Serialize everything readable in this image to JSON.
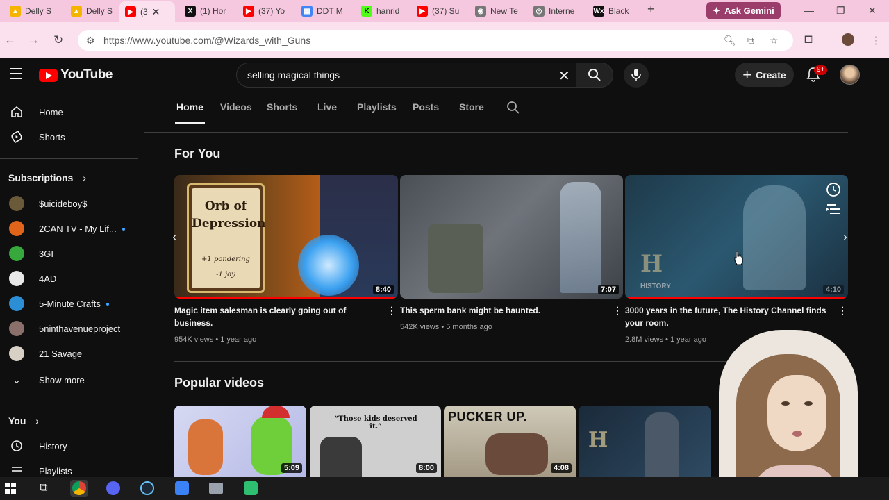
{
  "browser": {
    "tabs": [
      {
        "label": "Delly S",
        "favicon": "drive-icon"
      },
      {
        "label": "Delly S",
        "favicon": "drive-icon"
      },
      {
        "label": "(3",
        "favicon": "youtube-icon",
        "active": true
      },
      {
        "label": "(1) Hor",
        "favicon": "x-icon"
      },
      {
        "label": "(37) Yo",
        "favicon": "youtube-icon"
      },
      {
        "label": "DDT M",
        "favicon": "calendar-icon"
      },
      {
        "label": "hanrid",
        "favicon": "kick-icon"
      },
      {
        "label": "(37) Su",
        "favicon": "youtube-icon"
      },
      {
        "label": "New Te",
        "favicon": "chrome-icon"
      },
      {
        "label": "Interne",
        "favicon": "globe-icon"
      },
      {
        "label": "Black",
        "favicon": "wix-icon"
      }
    ],
    "ask_gemini": "Ask Gemini",
    "url": "https://www.youtube.com/@Wizards_with_Guns",
    "accent": "#f6c8df"
  },
  "header": {
    "logo_text": "YouTube",
    "search_value": "selling magical things",
    "create_label": "Create",
    "notifications_badge": "9+"
  },
  "sidebar": {
    "home": "Home",
    "shorts": "Shorts",
    "subscriptions_title": "Subscriptions",
    "subscriptions": [
      {
        "name": "$uicideboy$",
        "new": false,
        "color": "#6b5a3a"
      },
      {
        "name": "2CAN TV - My Lif...",
        "new": true,
        "color": "#e0641a"
      },
      {
        "name": "3GI",
        "new": false,
        "color": "#36a83c"
      },
      {
        "name": "4AD",
        "new": false,
        "color": "#e8e8e8"
      },
      {
        "name": "5-Minute Crafts",
        "new": true,
        "color": "#2c8fd6"
      },
      {
        "name": "5ninthavenueproject",
        "new": false,
        "color": "#8a6f6a"
      },
      {
        "name": "21 Savage",
        "new": false,
        "color": "#d8d0c4"
      }
    ],
    "show_more": "Show more",
    "you_title": "You",
    "history": "History",
    "playlists": "Playlists"
  },
  "channel_tabs": [
    "Home",
    "Videos",
    "Shorts",
    "Live",
    "Playlists",
    "Posts",
    "Store"
  ],
  "for_you": {
    "title": "For You",
    "videos": [
      {
        "title": "Magic item salesman is clearly going out of business.",
        "views": "954K views",
        "age": "1 year ago",
        "duration": "8:40",
        "progress": 1.0
      },
      {
        "title": "This sperm bank might be haunted.",
        "views": "542K views",
        "age": "5 months ago",
        "duration": "7:07",
        "progress": 0
      },
      {
        "title": "3000 years in the future, The History Channel finds your room.",
        "views": "2.8M views",
        "age": "1 year ago",
        "duration": "4:10",
        "progress": 1.0
      }
    ],
    "orb_card": {
      "line1": "Orb of",
      "line2": "Depression",
      "stat1": "+1 pondering",
      "stat2": "-1 joy"
    },
    "history_watermark": "HISTORY"
  },
  "popular": {
    "title": "Popular videos",
    "videos": [
      {
        "duration": "5:09"
      },
      {
        "duration": "8:00",
        "caption": "“Those kids deserved it.”"
      },
      {
        "duration": "4:08",
        "caption": "PUCKER UP."
      },
      {
        "duration": ""
      }
    ]
  }
}
